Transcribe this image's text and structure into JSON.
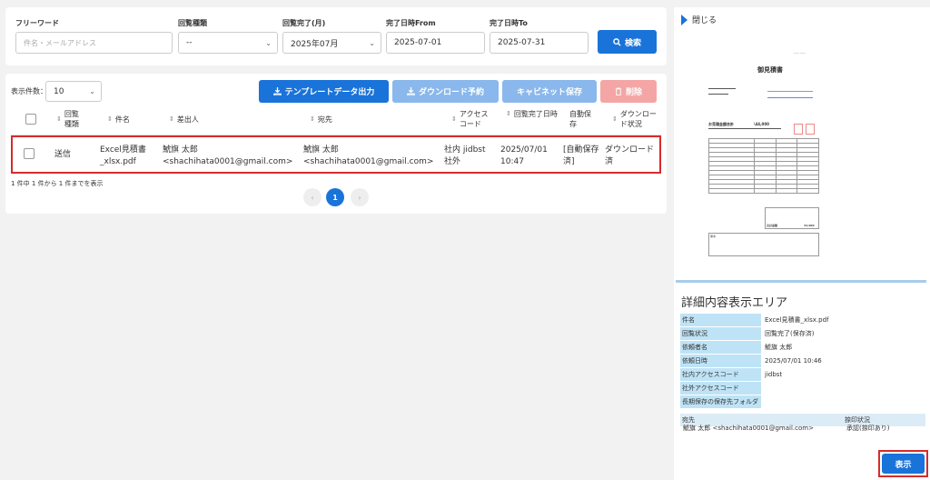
{
  "filters": {
    "keyword": {
      "label": "フリーワード",
      "placeholder": "件名・メールアドレス"
    },
    "type": {
      "label": "回覧種類",
      "value": "--"
    },
    "month": {
      "label": "回覧完了(月)",
      "value": "2025年07月"
    },
    "from": {
      "label": "完了日時From",
      "value": "2025-07-01"
    },
    "to": {
      "label": "完了日時To",
      "value": "2025-07-31"
    },
    "search_label": "検索"
  },
  "list": {
    "per_page_label": "表示件数：",
    "per_page_value": "10",
    "buttons": {
      "template": "テンプレートデータ出力",
      "download": "ダウンロード予約",
      "cabinet": "キャビネット保存",
      "delete": "削除"
    },
    "columns": {
      "type": "回覧種類",
      "subject": "件名",
      "sender": "差出人",
      "recipient": "宛先",
      "access": "アクセスコード",
      "completed": "回覧完了日時",
      "autosave": "自動保存",
      "download": "ダウンロード状況"
    },
    "row": {
      "type": "送信",
      "subject": "Excel見積書_xlsx.pdf",
      "sender_name": "鯱旗 太郎",
      "sender_email": "<shachihata0001@gmail.com>",
      "recipient_name": "鯱旗 太郎",
      "recipient_email": "<shachihata0001@gmail.com>",
      "access_1": "社内 jidbst",
      "access_2": "社外",
      "completed_date": "2025/07/01",
      "completed_time": "10:47",
      "autosave": "[自動保存済]",
      "download": "ダウンロード済"
    },
    "count_text": "1 件中 1 件から 1 件までを表示",
    "page": "1"
  },
  "panel": {
    "close_label": "閉じる",
    "doc_title": "御見積書",
    "doc_total_label": "お見積金額合計",
    "doc_total_value": "\\44,000",
    "doc_grand_total": "合計金額",
    "doc_grand_value": "44,000",
    "doc_note": "備考",
    "detail_title": "詳細内容表示エリア",
    "details": [
      {
        "label": "件名",
        "value": "Excel見積書_xlsx.pdf"
      },
      {
        "label": "回覧状況",
        "value": "回覧完了(保存済)"
      },
      {
        "label": "依頼者名",
        "value": "鯱旗 太郎"
      },
      {
        "label": "依頼日時",
        "value": "2025/07/01 10:46"
      },
      {
        "label": "社内アクセスコード",
        "value": "jidbst"
      },
      {
        "label": "社外アクセスコード",
        "value": ""
      },
      {
        "label": "長期保存の保存先フォルダ",
        "value": ""
      }
    ],
    "dest_header": "宛先",
    "stamp_header": "捺印状況",
    "dest_value": "鯱旗 太郎 <shachihata0001@gmail.com>",
    "stamp_value": "承認(捺印あり)",
    "show_label": "表示"
  }
}
